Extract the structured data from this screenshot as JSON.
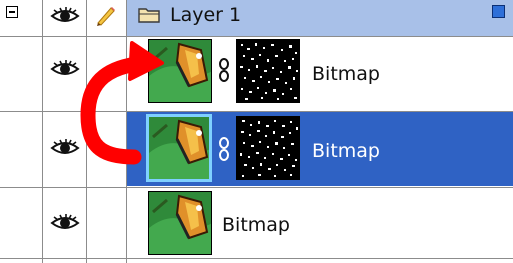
{
  "layer_group": {
    "name": "Layer 1",
    "icons": [
      "collapse-icon",
      "eye-icon",
      "pencil-icon",
      "folder-icon",
      "layer-color-square-icon"
    ]
  },
  "items": [
    {
      "label": "Bitmap",
      "has_mask": true,
      "selected": false
    },
    {
      "label": "Bitmap",
      "has_mask": true,
      "selected": true
    },
    {
      "label": "Bitmap",
      "has_mask": false,
      "selected": false
    }
  ],
  "colors": {
    "layer_strip": "#a8c0e8",
    "selection": "#2f62c4",
    "arrow": "#ff0000",
    "square": "#2e6fd8"
  }
}
